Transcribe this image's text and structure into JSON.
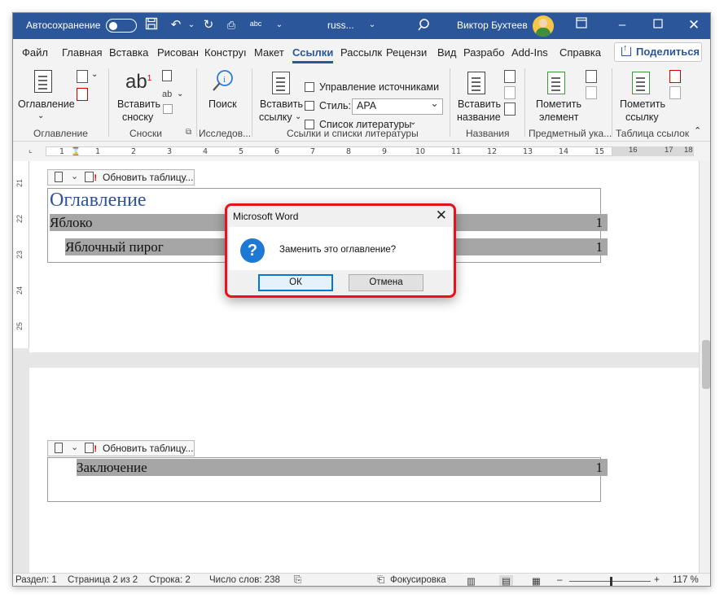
{
  "titlebar": {
    "autosave_label": "Автосохранение",
    "doc_name": "russ...",
    "user_name": "Виктор Бухтеев",
    "colors": {
      "bar": "#2b579a"
    }
  },
  "tabs": [
    {
      "label": "Файл"
    },
    {
      "label": "Главная"
    },
    {
      "label": "Вставка"
    },
    {
      "label": "Рисован"
    },
    {
      "label": "Конструı"
    },
    {
      "label": "Макет"
    },
    {
      "label": "Ссылки"
    },
    {
      "label": "Рассылк"
    },
    {
      "label": "Рецензи"
    },
    {
      "label": "Вид"
    },
    {
      "label": "Разрабо"
    },
    {
      "label": "Add-Ins"
    },
    {
      "label": "Справка"
    }
  ],
  "share_label": "Поделиться",
  "ribbon": {
    "toc_btn": "Оглавление",
    "footnote_btn_1": "Вставить",
    "footnote_btn_2": "сноску",
    "search_btn": "Поиск",
    "cite_btn_1": "Вставить",
    "cite_btn_2": "ссылку",
    "manage_sources": "Управление источниками",
    "style_label": "Стиль:",
    "style_value": "APA",
    "bibliography": "Список литературы",
    "caption_btn_1": "Вставить",
    "caption_btn_2": "название",
    "mark_entry_1": "Пометить",
    "mark_entry_2": "элемент",
    "mark_cit_1": "Пометить",
    "mark_cit_2": "ссылку",
    "groups": {
      "toc": "Оглавление",
      "footnotes": "Сноски",
      "research": "Исследов...",
      "citations": "Ссылки и списки литературы",
      "captions": "Названия",
      "index": "Предметный ука...",
      "authorities": "Таблица ссылок"
    }
  },
  "ruler": {
    "h_numbers": [
      "1",
      "1",
      "2",
      "3",
      "4",
      "5",
      "6",
      "7",
      "8",
      "9",
      "10",
      "11",
      "12",
      "13",
      "14",
      "15",
      "16",
      "17",
      "18"
    ],
    "v_numbers": [
      "21",
      "22",
      "23",
      "24",
      "25"
    ]
  },
  "document": {
    "toc_toolbar_label": "Обновить таблицу...",
    "toc_heading": "Оглавление",
    "entries": [
      {
        "text": "Яблоко",
        "page": "1"
      },
      {
        "text": "Яблочный пирог",
        "page": "1"
      }
    ],
    "page2_entries": [
      {
        "text": "Заключение",
        "page": "1"
      }
    ]
  },
  "dialog": {
    "title": "Microsoft Word",
    "message": "Заменить это оглавление?",
    "ok": "ОК",
    "cancel": "Отмена",
    "highlight_color": "#e8111d"
  },
  "statusbar": {
    "section": "Раздел: 1",
    "page": "Страница 2 из 2",
    "line": "Строка: 2",
    "words": "Число слов: 238",
    "focus": "Фокусировка",
    "zoom": "117 %"
  }
}
